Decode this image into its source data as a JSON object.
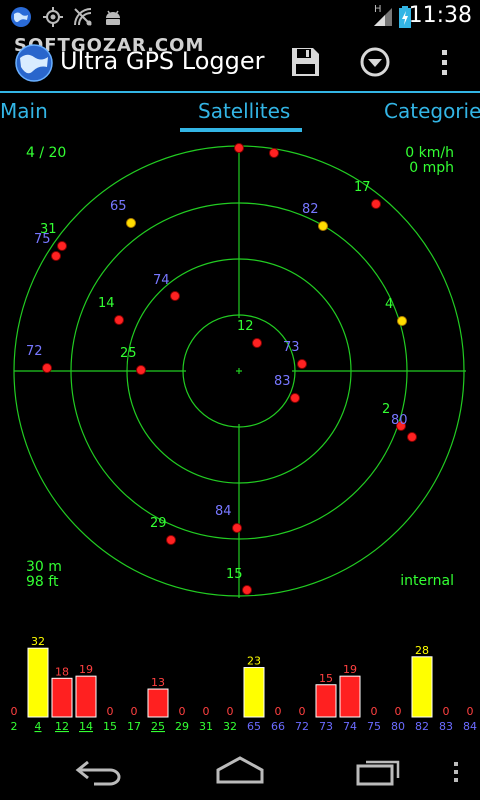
{
  "status": {
    "time": "11:38",
    "network": "H"
  },
  "app": {
    "title": "Ultra GPS Logger",
    "watermark": "SOFTGOZAR.COM"
  },
  "tabs": [
    {
      "label": "Main"
    },
    {
      "label": "Satellites"
    },
    {
      "label": "Categories"
    }
  ],
  "sky": {
    "sat_count": "4 / 20",
    "speed_kmh": "0 km/h",
    "speed_mph": "0 mph",
    "alt_m": "30 m",
    "alt_ft": "98 ft",
    "source": "internal",
    "colors": {
      "grid": "#22cc22",
      "green_label": "#33ff33",
      "blue_label": "#7777ff",
      "used_dot": "#ffdd00",
      "unused_dot": "#ff2222"
    }
  },
  "satellites": [
    {
      "prn": "12",
      "dot": [
        257,
        211
      ],
      "label": [
        237,
        198
      ],
      "lc": "green",
      "dc": "red"
    },
    {
      "prn": "73",
      "dot": [
        302,
        232
      ],
      "label": [
        283,
        219
      ],
      "lc": "blue",
      "dc": "red"
    },
    {
      "prn": "83",
      "dot": [
        295,
        266
      ],
      "label": [
        274,
        253
      ],
      "lc": "blue",
      "dc": "red"
    },
    {
      "prn": "74",
      "dot": [
        175,
        164
      ],
      "label": [
        153,
        152
      ],
      "lc": "blue",
      "dc": "red"
    },
    {
      "prn": "14",
      "dot": [
        119,
        188
      ],
      "label": [
        98,
        175
      ],
      "lc": "green",
      "dc": "red"
    },
    {
      "prn": "25",
      "dot": [
        141,
        238
      ],
      "label": [
        120,
        225
      ],
      "lc": "green",
      "dc": "red"
    },
    {
      "prn": "72",
      "dot": [
        47,
        236
      ],
      "label": [
        26,
        223
      ],
      "lc": "blue",
      "dc": "red"
    },
    {
      "prn": "31",
      "dot": [
        62,
        114
      ],
      "label": [
        40,
        101
      ],
      "lc": "green",
      "dc": "red"
    },
    {
      "prn": "75",
      "dot": [
        56,
        124
      ],
      "label": [
        34,
        111
      ],
      "lc": "blue",
      "dc": "red"
    },
    {
      "prn": "65",
      "dot": [
        131,
        91
      ],
      "label": [
        110,
        78
      ],
      "lc": "blue",
      "dc": "yellow"
    },
    {
      "prn": "82",
      "dot": [
        323,
        94
      ],
      "label": [
        302,
        81
      ],
      "lc": "blue",
      "dc": "yellow"
    },
    {
      "prn": "17",
      "dot": [
        376,
        72
      ],
      "label": [
        354,
        59
      ],
      "lc": "green",
      "dc": "red"
    },
    {
      "prn": "4",
      "dot": [
        402,
        189
      ],
      "label": [
        385,
        176
      ],
      "lc": "green",
      "dc": "yellow"
    },
    {
      "prn": "2",
      "dot": [
        401,
        294
      ],
      "label": [
        382,
        281
      ],
      "lc": "green",
      "dc": "red"
    },
    {
      "prn": "80",
      "dot": [
        412,
        305
      ],
      "label": [
        391,
        292
      ],
      "lc": "blue",
      "dc": "red"
    },
    {
      "prn": "84",
      "dot": [
        237,
        396
      ],
      "label": [
        215,
        383
      ],
      "lc": "blue",
      "dc": "red"
    },
    {
      "prn": "29",
      "dot": [
        171,
        408
      ],
      "label": [
        150,
        395
      ],
      "lc": "green",
      "dc": "red"
    },
    {
      "prn": "15",
      "dot": [
        247,
        458
      ],
      "label": [
        226,
        446
      ],
      "lc": "green",
      "dc": "red"
    },
    {
      "prn": "",
      "dot": [
        239,
        16
      ],
      "label": [
        0,
        0
      ],
      "lc": "green",
      "dc": "red"
    },
    {
      "prn": "",
      "dot": [
        274,
        21
      ],
      "label": [
        0,
        0
      ],
      "lc": "green",
      "dc": "red"
    }
  ],
  "snr_bars": [
    {
      "prn": "2",
      "snr": 0,
      "used": false,
      "underline": false
    },
    {
      "prn": "4",
      "snr": 32,
      "used": true,
      "underline": true
    },
    {
      "prn": "12",
      "snr": 18,
      "used": false,
      "underline": true
    },
    {
      "prn": "14",
      "snr": 19,
      "used": false,
      "underline": true
    },
    {
      "prn": "15",
      "snr": 0,
      "used": false,
      "underline": false
    },
    {
      "prn": "17",
      "snr": 0,
      "used": false,
      "underline": false
    },
    {
      "prn": "25",
      "snr": 13,
      "used": false,
      "underline": true
    },
    {
      "prn": "29",
      "snr": 0,
      "used": false,
      "underline": false
    },
    {
      "prn": "31",
      "snr": 0,
      "used": false,
      "underline": false
    },
    {
      "prn": "32",
      "snr": 0,
      "used": false,
      "underline": false
    },
    {
      "prn": "65",
      "snr": 23,
      "used": true,
      "underline": false
    },
    {
      "prn": "66",
      "snr": 0,
      "used": false,
      "underline": false
    },
    {
      "prn": "72",
      "snr": 0,
      "used": false,
      "underline": false
    },
    {
      "prn": "73",
      "snr": 15,
      "used": false,
      "underline": false
    },
    {
      "prn": "74",
      "snr": 19,
      "used": false,
      "underline": false
    },
    {
      "prn": "75",
      "snr": 0,
      "used": false,
      "underline": false
    },
    {
      "prn": "80",
      "snr": 0,
      "used": false,
      "underline": false
    },
    {
      "prn": "82",
      "snr": 28,
      "used": true,
      "underline": false
    },
    {
      "prn": "83",
      "snr": 0,
      "used": false,
      "underline": false
    },
    {
      "prn": "84",
      "snr": 0,
      "used": false,
      "underline": false
    }
  ],
  "snr_colors": {
    "used": "#ffff00",
    "unused": "#ff2020",
    "green_prn": "#33ff33",
    "blue_prn": "#6b6bff",
    "value_used": "#ffff00",
    "value_unused": "#ff4040"
  },
  "icons": {
    "save": "save-icon",
    "dropdown": "dropdown-circle-icon",
    "overflow": "overflow-menu-icon",
    "back": "back-icon",
    "home": "home-icon",
    "recents": "recents-icon"
  }
}
